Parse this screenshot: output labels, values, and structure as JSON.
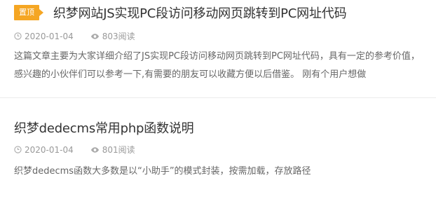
{
  "articles": [
    {
      "badge": "置顶",
      "title": "织梦网站JS实现PC段访问移动网页跳转到PC网址代码",
      "date": "2020-01-04",
      "views": "803阅读",
      "excerpt": "这篇文章主要为大家详细介绍了JS实现PC段访问移动网页跳转到PC网址代码，具有一定的参考价值，感兴趣的小伙伴们可以参考一下,有需要的朋友可以收藏方便以后借鉴。 刚有个用户想做"
    },
    {
      "title": "织梦dedecms常用php函数说明",
      "date": "2020-01-04",
      "views": "801阅读",
      "excerpt": "织梦dedecms函数大多数是以“小助手”的模式封装，按需加载，存放路径"
    }
  ],
  "colors": {
    "badge": "#f5a623",
    "title": "#333333",
    "meta": "#999999",
    "excerpt": "#666666"
  },
  "icons": {
    "date": "clock-icon",
    "views": "eye-icon"
  }
}
